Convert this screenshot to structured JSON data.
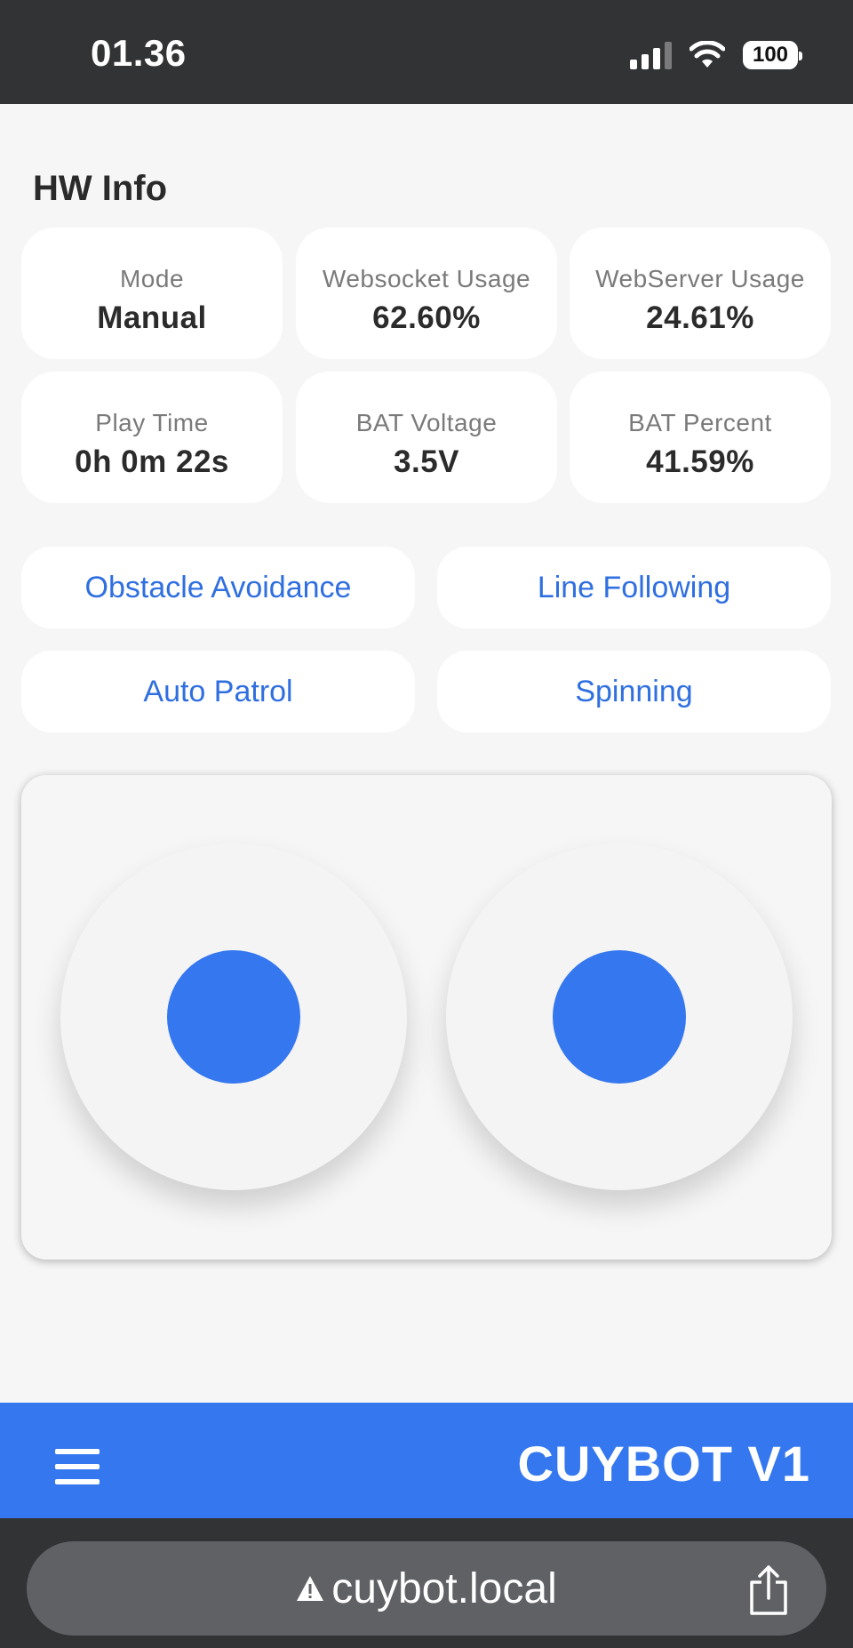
{
  "status_bar": {
    "time": "01.36",
    "battery_level": "100",
    "icons": [
      "cellular-signal-icon",
      "wifi-icon",
      "battery-icon"
    ]
  },
  "hw_info": {
    "title": "HW Info",
    "cards": [
      {
        "label": "Mode",
        "value": "Manual"
      },
      {
        "label": "Websocket Usage",
        "value": "62.60%"
      },
      {
        "label": "WebServer Usage",
        "value": "24.61%"
      },
      {
        "label": "Play Time",
        "value": "0h 0m 22s"
      },
      {
        "label": "BAT Voltage",
        "value": "3.5V"
      },
      {
        "label": "BAT Percent",
        "value": "41.59%"
      }
    ]
  },
  "modes": [
    {
      "label": "Obstacle Avoidance"
    },
    {
      "label": "Line Following"
    },
    {
      "label": "Auto Patrol"
    },
    {
      "label": "Spinning"
    }
  ],
  "app_bar": {
    "title": "CUYBOT V1",
    "menu_icon": "hamburger-menu-icon"
  },
  "browser": {
    "url": "cuybot.local",
    "warning_icon": "warning-icon",
    "share_icon": "share-icon"
  },
  "colors": {
    "accent": "#3477ef",
    "link": "#2f6fe0",
    "background": "#f6f6f6",
    "dark_bar": "#323335"
  }
}
